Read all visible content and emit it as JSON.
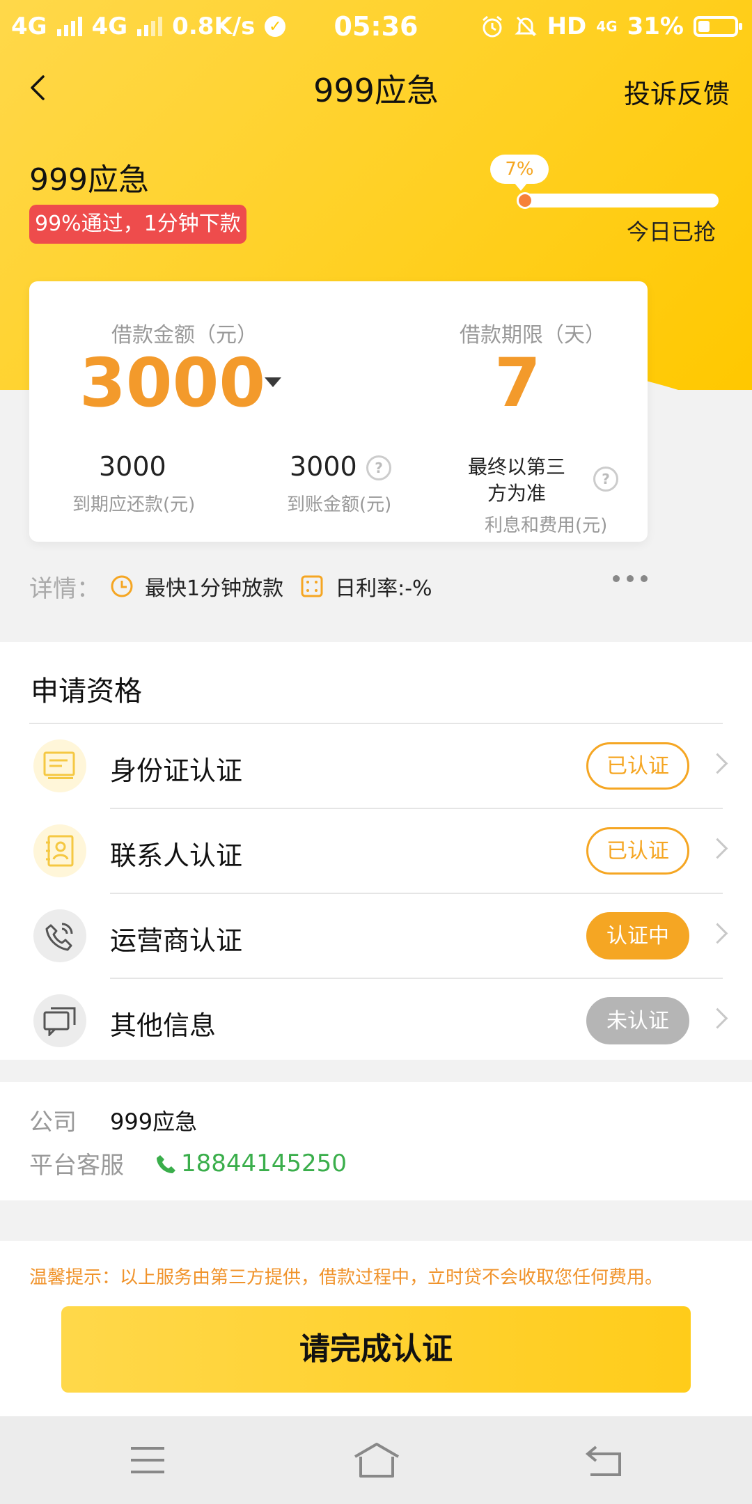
{
  "status_bar": {
    "net1": "4G",
    "net2": "4G",
    "speed": "0.8K/s",
    "time": "05:36",
    "hd": "HD",
    "net3": "4G",
    "battery": "31%"
  },
  "nav": {
    "title": "999应急",
    "right_action": "投诉反馈"
  },
  "product": {
    "name": "999应急",
    "badge": "99%通过，1分钟下款",
    "progress_label": "7%",
    "progress_value": 0.07,
    "progress_caption": "今日已抢"
  },
  "loan": {
    "amount_label": "借款金额（元）",
    "amount": "3000",
    "term_label": "借款期限（天）",
    "term": "7",
    "repay_value": "3000",
    "repay_label": "到期应还款(元)",
    "received_value": "3000",
    "received_label": "到账金额(元)",
    "fee_note": "最终以第三方为准",
    "fee_label": "利息和费用(元)"
  },
  "details": {
    "label": "详情：",
    "item1": "最快1分钟放款",
    "item2": "日利率:-%"
  },
  "qualification": {
    "title": "申请资格",
    "items": [
      {
        "label": "身份证认证",
        "status": "已认证",
        "icon": "id-card-icon"
      },
      {
        "label": "联系人认证",
        "status": "已认证",
        "icon": "contact-card-icon"
      },
      {
        "label": "运营商认证",
        "status": "认证中",
        "icon": "phone-icon"
      },
      {
        "label": "其他信息",
        "status": "未认证",
        "icon": "chat-icon"
      }
    ]
  },
  "company": {
    "company_label": "公司",
    "company_value": "999应急",
    "service_label": "平台客服",
    "service_phone": "18844145250"
  },
  "footer": {
    "tip": "温馨提示：以上服务由第三方提供，借款过程中，立时贷不会收取您任何费用。",
    "cta": "请完成认证"
  },
  "colors": {
    "brand_yellow": "#ffd126",
    "accent_orange": "#f39a2b",
    "badge_red": "#ee4c4c",
    "phone_green": "#3aae4b"
  }
}
